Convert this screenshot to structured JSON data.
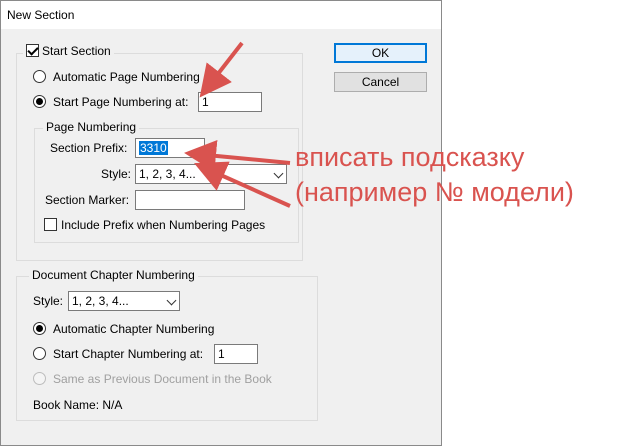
{
  "title": "New Section",
  "start_section_label": "Start Section",
  "start_section_checked": true,
  "buttons": {
    "ok": "OK",
    "cancel": "Cancel"
  },
  "auto_page_numbering": "Automatic Page Numbering",
  "start_page_numbering": "Start Page Numbering at:",
  "start_page_value": "1",
  "page_numbering_group": {
    "title": "Page Numbering",
    "section_prefix_label": "Section Prefix:",
    "section_prefix_value": "3310",
    "style_label": "Style:",
    "style_value": "1, 2, 3, 4...",
    "section_marker_label": "Section Marker:",
    "section_marker_value": "",
    "include_prefix_label": "Include Prefix when Numbering Pages",
    "include_prefix_checked": false
  },
  "chapter_group": {
    "title": "Document Chapter Numbering",
    "style_label": "Style:",
    "style_value": "1, 2, 3, 4...",
    "auto_chapter": "Automatic Chapter Numbering",
    "start_chapter": "Start Chapter Numbering at:",
    "start_chapter_value": "1",
    "same_as_previous": "Same as Previous Document in the Book",
    "book_name": "Book Name: N/A"
  },
  "annotation": {
    "line1": "вписать подсказку",
    "line2": "(например № модели)",
    "color": "#d9534f"
  }
}
